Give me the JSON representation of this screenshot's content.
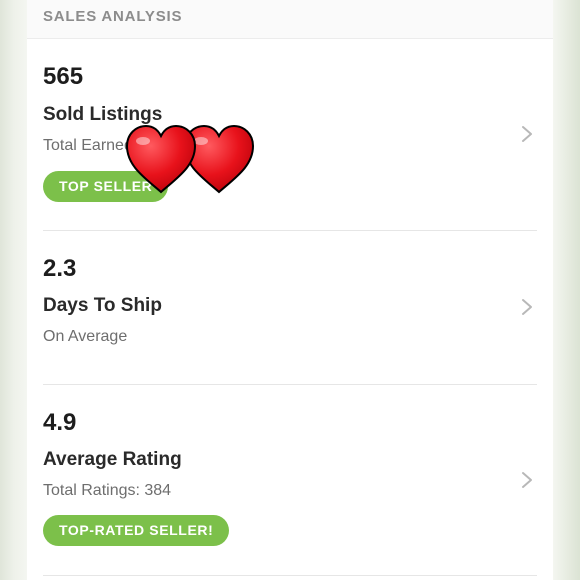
{
  "section": {
    "title": "SALES ANALYSIS"
  },
  "stats": [
    {
      "value": "565",
      "title": "Sold Listings",
      "subtitle": "Total Earned:",
      "badge": "TOP SELLER"
    },
    {
      "value": "2.3",
      "title": "Days To Ship",
      "subtitle": "On Average"
    },
    {
      "value": "4.9",
      "title": "Average Rating",
      "subtitle": "Total Ratings: 384",
      "badge": "TOP-RATED SELLER!"
    }
  ],
  "colors": {
    "badge": "#7cc04a",
    "heart": "#e8121b",
    "chevron": "#b8b8b8"
  },
  "icons": {
    "chevron": "chevron-right-icon",
    "sticker": "heart-icon"
  }
}
